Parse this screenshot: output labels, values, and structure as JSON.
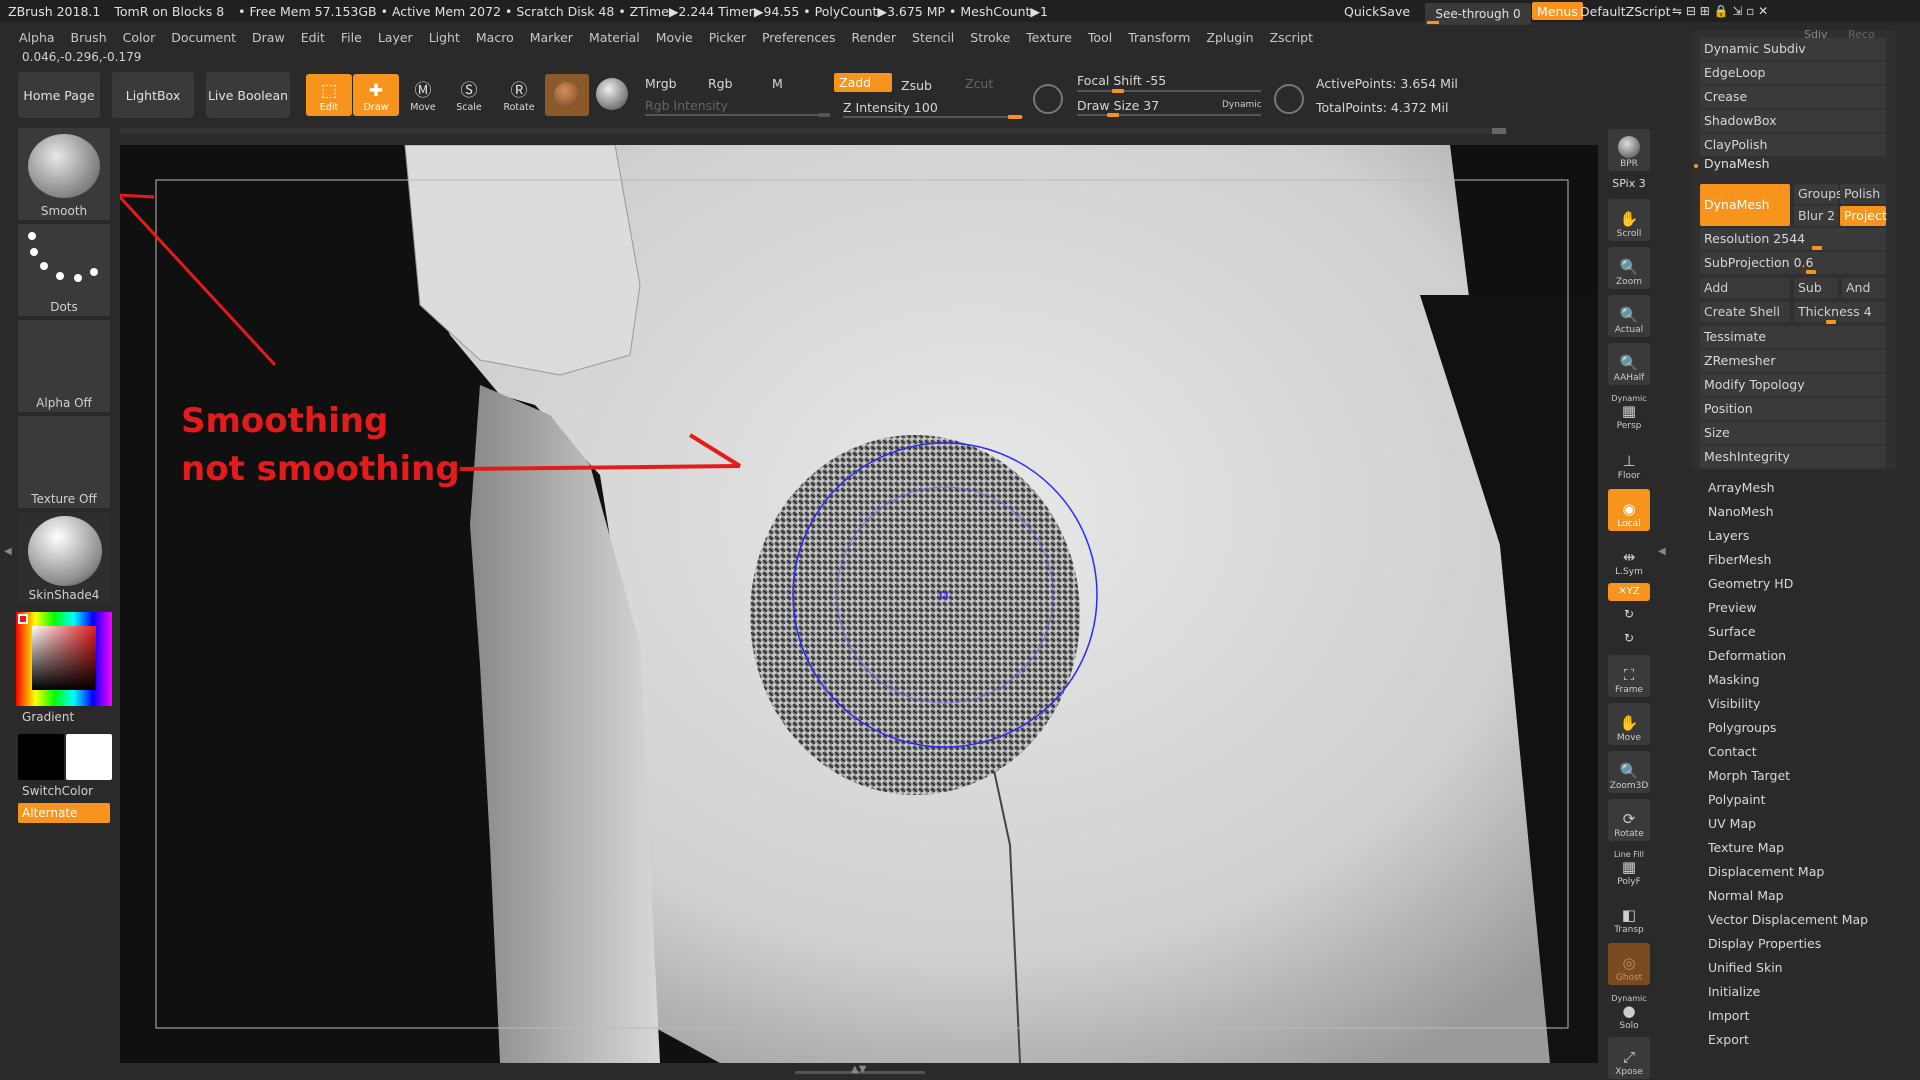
{
  "titlebar": {
    "app": "ZBrush 2018.1",
    "project": "TomR on Blocks 8",
    "stats": "• Free Mem 57.153GB • Active Mem 2072 • Scratch Disk 48 • ZTime▶2.244 Timer▶94.55 • PolyCount▶3.675 MP • MeshCount▶1",
    "quicksave": "QuickSave",
    "see_through": "See-through  0",
    "menus": "Menus",
    "script": "DefaultZScript",
    "window_controls": "⇋  ⊟  ⊞  🔒  ⇲  ▫  ✕"
  },
  "menubar": [
    "Alpha",
    "Brush",
    "Color",
    "Document",
    "Draw",
    "Edit",
    "File",
    "Layer",
    "Light",
    "Macro",
    "Marker",
    "Material",
    "Movie",
    "Picker",
    "Preferences",
    "Render",
    "Stencil",
    "Stroke",
    "Texture",
    "Tool",
    "Transform",
    "Zplugin",
    "Zscript"
  ],
  "coords": "0.046,-0.296,-0.179",
  "toolbar": {
    "home_page": "Home Page",
    "lightbox": "LightBox",
    "live_boolean": "Live Boolean",
    "edit": "Edit",
    "draw": "Draw",
    "move": "Move",
    "scale": "Scale",
    "rotate": "Rotate",
    "mrgb": "Mrgb",
    "rgb": "Rgb",
    "m": "M",
    "rgb_intensity": "Rgb Intensity",
    "zadd": "Zadd",
    "zsub": "Zsub",
    "zcut": "Zcut",
    "z_intensity": "Z Intensity 100",
    "focal_shift": "Focal Shift -55",
    "draw_size": "Draw Size 37",
    "dynamic": "Dynamic",
    "active_points": "ActivePoints: 3.654 Mil",
    "total_points": "TotalPoints: 4.372 Mil"
  },
  "leftpanel": {
    "brush": "Smooth",
    "stroke": "Dots",
    "alpha": "Alpha Off",
    "texture": "Texture Off",
    "material": "SkinShade4",
    "gradient": "Gradient",
    "switchcolor": "SwitchColor",
    "alternate": "Alternate"
  },
  "annotation": {
    "line1": "Smoothing",
    "line2": "not smoothing"
  },
  "righttools": {
    "bpr": "BPR",
    "spix": "SPix 3",
    "scroll": "Scroll",
    "zoom": "Zoom",
    "actual": "Actual",
    "aahalf": "AAHalf",
    "dynamic": "Dynamic",
    "persp": "Persp",
    "floor": "Floor",
    "local": "Local",
    "lsym": "L.Sym",
    "xyz": "✕YZ",
    "frame": "Frame",
    "move": "Move",
    "zoom3d": "Zoom3D",
    "rotate": "Rotate",
    "linefill": "Line Fill",
    "polyf": "PolyF",
    "transp": "Transp",
    "ghost": "Ghost",
    "dynamic2": "Dynamic",
    "solo": "Solo",
    "xpose": "Xpose"
  },
  "rightpanel": {
    "sdiv_label": "Sdiv",
    "reconstruct_label": "Reco",
    "dynamic_subdiv": "Dynamic Subdiv",
    "edgeloop": "EdgeLoop",
    "crease": "Crease",
    "shadowbox": "ShadowBox",
    "claypolish": "ClayPolish",
    "dynamesh_header": "DynaMesh",
    "dynamesh_btn": "DynaMesh",
    "groups": "Groups",
    "polish": "Polish",
    "blur": "Blur 2",
    "project": "Project",
    "resolution": "Resolution 2544",
    "subprojection": "SubProjection 0.6",
    "add": "Add",
    "sub": "Sub",
    "and": "And",
    "create_shell": "Create Shell",
    "thickness": "Thickness 4",
    "tessimate": "Tessimate",
    "zremesher": "ZRemesher",
    "modify_topology": "Modify Topology",
    "position": "Position",
    "size": "Size",
    "meshintegrity": "MeshIntegrity"
  },
  "submenu": [
    "ArrayMesh",
    "NanoMesh",
    "Layers",
    "FiberMesh",
    "Geometry HD",
    "Preview",
    "Surface",
    "Deformation",
    "Masking",
    "Visibility",
    "Polygroups",
    "Contact",
    "Morph Target",
    "Polypaint",
    "UV Map",
    "Texture Map",
    "Displacement Map",
    "Normal Map",
    "Vector Displacement Map",
    "Display Properties",
    "Unified Skin",
    "Initialize",
    "Import",
    "Export"
  ],
  "colors": {
    "accent": "#f7941d",
    "annotation_red": "#e41b1b",
    "brush_circle": "#2a2aff"
  }
}
